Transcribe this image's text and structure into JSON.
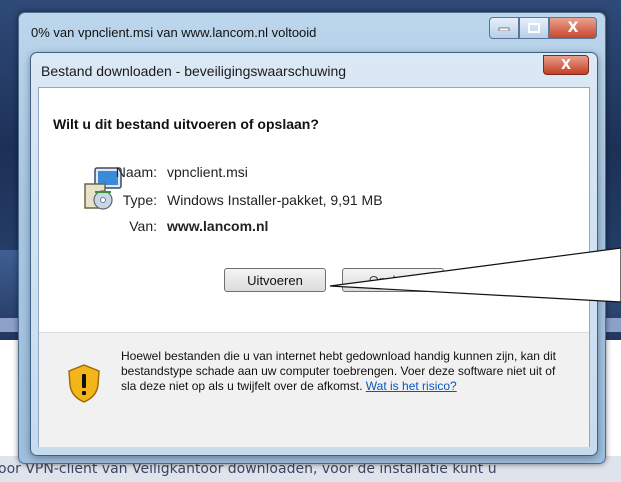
{
  "outer_window": {
    "title": "0% van vpnclient.msi van www.lancom.nl voltooid",
    "minimize_icon": "minimize-icon",
    "maximize_icon": "maximize-icon",
    "close_label": "X"
  },
  "dialog": {
    "title": "Bestand downloaden - beveiligingswaarschuwing",
    "close_label": "X",
    "question": "Wilt u dit bestand uitvoeren of opslaan?",
    "fields": [
      {
        "label": "Naam:",
        "value": "vpnclient.msi"
      },
      {
        "label": "Type:",
        "value": "Windows Installer-pakket, 9,91 MB"
      },
      {
        "label": "Van:",
        "value": "www.lancom.nl"
      }
    ],
    "buttons": {
      "run": "Uitvoeren",
      "save": "Opslaan",
      "cancel": ""
    },
    "warning": {
      "text": "Hoewel bestanden die u van internet hebt gedownload handig kunnen zijn, kan dit bestandstype schade aan uw computer toebrengen. Voer deze software niet uit of sla deze niet op als u twijfelt over de afkomst.",
      "link": "Wat is het risico?"
    }
  },
  "background": {
    "caption": "oor VPN-client van Veiligkantoor downloaden, voor de installatie kunt u"
  },
  "colors": {
    "accent_blue": "#3c7fb1",
    "close_red": "#c53e25",
    "link": "#0a55c4"
  }
}
